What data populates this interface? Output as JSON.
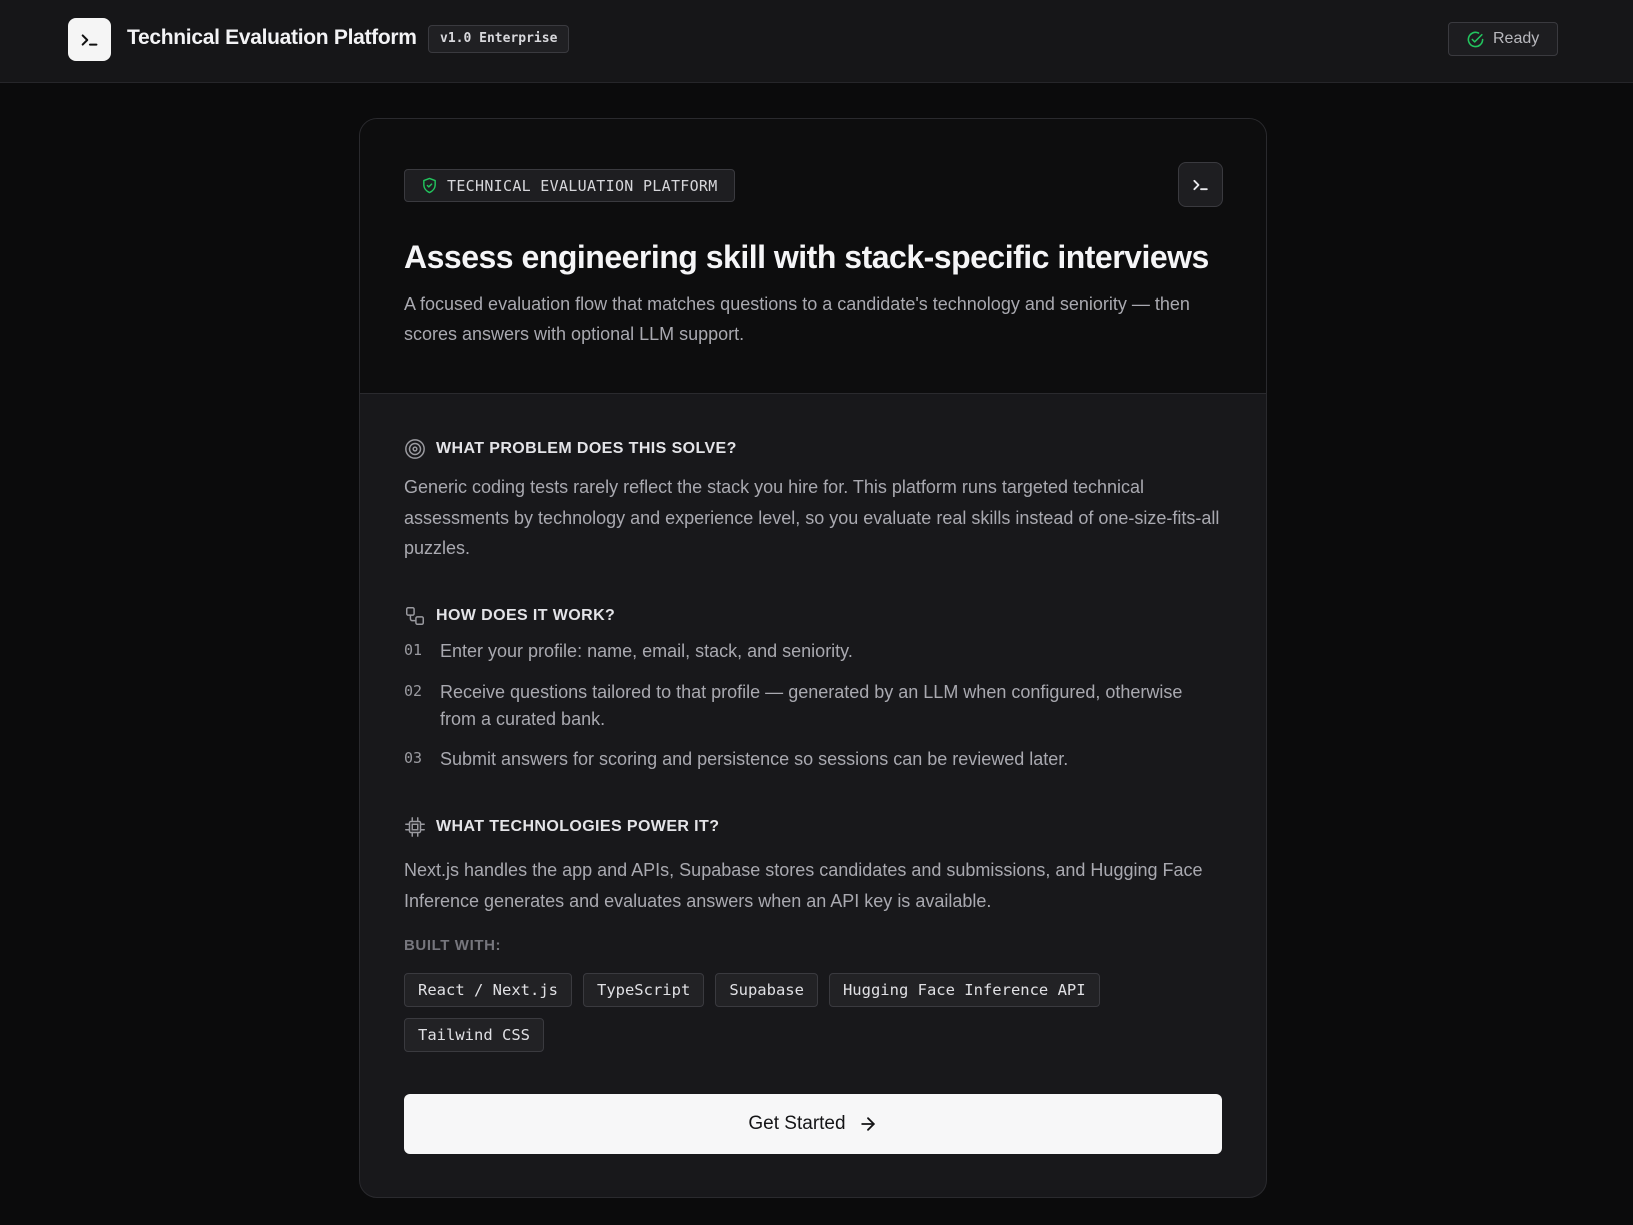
{
  "header": {
    "app_title": "Technical Evaluation Platform",
    "version_badge": "v1.0 Enterprise",
    "status_label": "Ready",
    "logo_icon": "terminal-icon",
    "status_icon": "check-circle-icon",
    "status_color": "#22c55e"
  },
  "card": {
    "tag_label": "TECHNICAL EVALUATION PLATFORM",
    "tag_icon": "shield-check-icon",
    "headline": "Assess engineering skill with stack-specific interviews",
    "subhead": "A focused evaluation flow that matches questions to a candidate's technology and seniority — then scores answers with optional LLM support.",
    "problem": {
      "title": "WHAT PROBLEM DOES THIS SOLVE?",
      "icon": "target-icon",
      "text": "Generic coding tests rarely reflect the stack you hire for. This platform runs targeted technical assessments by technology and experience level, so you evaluate real skills instead of one-size-fits-all puzzles."
    },
    "how": {
      "title": "HOW DOES IT WORK?",
      "icon": "workflow-icon",
      "steps": [
        {
          "num": "01",
          "text": "Enter your profile: name, email, stack, and seniority."
        },
        {
          "num": "02",
          "text": "Receive questions tailored to that profile — generated by an LLM when configured, otherwise from a curated bank."
        },
        {
          "num": "03",
          "text": "Submit answers for scoring and persistence so sessions can be reviewed later."
        }
      ]
    },
    "tech": {
      "title": "WHAT TECHNOLOGIES POWER IT?",
      "icon": "cpu-icon",
      "text": "Next.js handles the app and APIs, Supabase stores candidates and submissions, and Hugging Face Inference generates and evaluates answers when an API key is available.",
      "built_label": "BUILT WITH:",
      "chips": [
        "React / Next.js",
        "TypeScript",
        "Supabase",
        "Hugging Face Inference API",
        "Tailwind CSS"
      ]
    },
    "cta_label": "Get Started",
    "cta_icon": "arrow-right-icon"
  }
}
